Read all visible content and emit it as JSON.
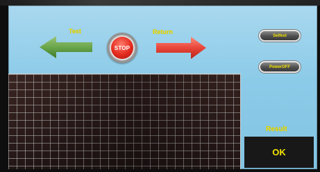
{
  "labels": {
    "test": "Test",
    "return": "Return",
    "result": "Result"
  },
  "buttons": {
    "stop": "STOP",
    "pill_1": "Seifest",
    "pill_2": "PowerOFF"
  },
  "result": {
    "value": "OK"
  },
  "colors": {
    "screen_bg": "#8ccbe8",
    "label_yellow": "#f2e200",
    "arrow_left_green": "#6aa64a",
    "arrow_right_red": "#e8473a",
    "stop_red": "#e32a1e",
    "result_bg": "#181818"
  },
  "icons": {
    "left_arrow": "left-arrow-icon",
    "right_arrow": "right-arrow-icon"
  }
}
